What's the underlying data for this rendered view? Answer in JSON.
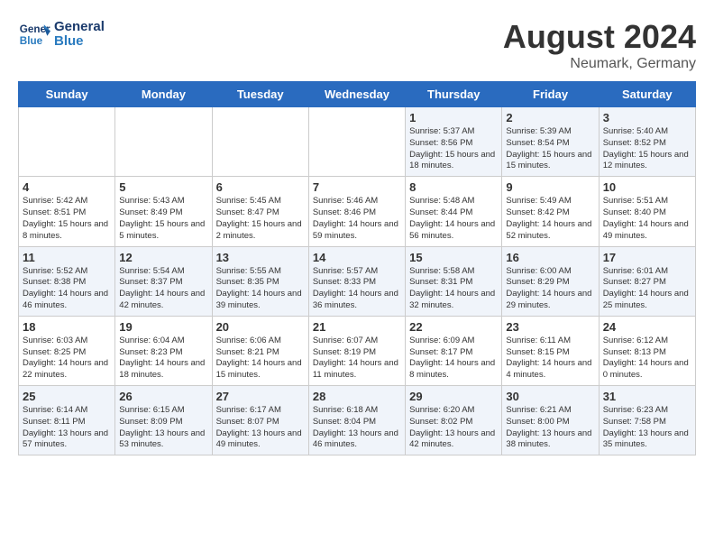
{
  "header": {
    "logo_line1": "General",
    "logo_line2": "Blue",
    "title": "August 2024",
    "subtitle": "Neumark, Germany"
  },
  "days_of_week": [
    "Sunday",
    "Monday",
    "Tuesday",
    "Wednesday",
    "Thursday",
    "Friday",
    "Saturday"
  ],
  "weeks": [
    [
      {
        "day": "",
        "content": ""
      },
      {
        "day": "",
        "content": ""
      },
      {
        "day": "",
        "content": ""
      },
      {
        "day": "",
        "content": ""
      },
      {
        "day": "1",
        "content": "Sunrise: 5:37 AM\nSunset: 8:56 PM\nDaylight: 15 hours\nand 18 minutes."
      },
      {
        "day": "2",
        "content": "Sunrise: 5:39 AM\nSunset: 8:54 PM\nDaylight: 15 hours\nand 15 minutes."
      },
      {
        "day": "3",
        "content": "Sunrise: 5:40 AM\nSunset: 8:52 PM\nDaylight: 15 hours\nand 12 minutes."
      }
    ],
    [
      {
        "day": "4",
        "content": "Sunrise: 5:42 AM\nSunset: 8:51 PM\nDaylight: 15 hours\nand 8 minutes."
      },
      {
        "day": "5",
        "content": "Sunrise: 5:43 AM\nSunset: 8:49 PM\nDaylight: 15 hours\nand 5 minutes."
      },
      {
        "day": "6",
        "content": "Sunrise: 5:45 AM\nSunset: 8:47 PM\nDaylight: 15 hours\nand 2 minutes."
      },
      {
        "day": "7",
        "content": "Sunrise: 5:46 AM\nSunset: 8:46 PM\nDaylight: 14 hours\nand 59 minutes."
      },
      {
        "day": "8",
        "content": "Sunrise: 5:48 AM\nSunset: 8:44 PM\nDaylight: 14 hours\nand 56 minutes."
      },
      {
        "day": "9",
        "content": "Sunrise: 5:49 AM\nSunset: 8:42 PM\nDaylight: 14 hours\nand 52 minutes."
      },
      {
        "day": "10",
        "content": "Sunrise: 5:51 AM\nSunset: 8:40 PM\nDaylight: 14 hours\nand 49 minutes."
      }
    ],
    [
      {
        "day": "11",
        "content": "Sunrise: 5:52 AM\nSunset: 8:38 PM\nDaylight: 14 hours\nand 46 minutes."
      },
      {
        "day": "12",
        "content": "Sunrise: 5:54 AM\nSunset: 8:37 PM\nDaylight: 14 hours\nand 42 minutes."
      },
      {
        "day": "13",
        "content": "Sunrise: 5:55 AM\nSunset: 8:35 PM\nDaylight: 14 hours\nand 39 minutes."
      },
      {
        "day": "14",
        "content": "Sunrise: 5:57 AM\nSunset: 8:33 PM\nDaylight: 14 hours\nand 36 minutes."
      },
      {
        "day": "15",
        "content": "Sunrise: 5:58 AM\nSunset: 8:31 PM\nDaylight: 14 hours\nand 32 minutes."
      },
      {
        "day": "16",
        "content": "Sunrise: 6:00 AM\nSunset: 8:29 PM\nDaylight: 14 hours\nand 29 minutes."
      },
      {
        "day": "17",
        "content": "Sunrise: 6:01 AM\nSunset: 8:27 PM\nDaylight: 14 hours\nand 25 minutes."
      }
    ],
    [
      {
        "day": "18",
        "content": "Sunrise: 6:03 AM\nSunset: 8:25 PM\nDaylight: 14 hours\nand 22 minutes."
      },
      {
        "day": "19",
        "content": "Sunrise: 6:04 AM\nSunset: 8:23 PM\nDaylight: 14 hours\nand 18 minutes."
      },
      {
        "day": "20",
        "content": "Sunrise: 6:06 AM\nSunset: 8:21 PM\nDaylight: 14 hours\nand 15 minutes."
      },
      {
        "day": "21",
        "content": "Sunrise: 6:07 AM\nSunset: 8:19 PM\nDaylight: 14 hours\nand 11 minutes."
      },
      {
        "day": "22",
        "content": "Sunrise: 6:09 AM\nSunset: 8:17 PM\nDaylight: 14 hours\nand 8 minutes."
      },
      {
        "day": "23",
        "content": "Sunrise: 6:11 AM\nSunset: 8:15 PM\nDaylight: 14 hours\nand 4 minutes."
      },
      {
        "day": "24",
        "content": "Sunrise: 6:12 AM\nSunset: 8:13 PM\nDaylight: 14 hours\nand 0 minutes."
      }
    ],
    [
      {
        "day": "25",
        "content": "Sunrise: 6:14 AM\nSunset: 8:11 PM\nDaylight: 13 hours\nand 57 minutes."
      },
      {
        "day": "26",
        "content": "Sunrise: 6:15 AM\nSunset: 8:09 PM\nDaylight: 13 hours\nand 53 minutes."
      },
      {
        "day": "27",
        "content": "Sunrise: 6:17 AM\nSunset: 8:07 PM\nDaylight: 13 hours\nand 49 minutes."
      },
      {
        "day": "28",
        "content": "Sunrise: 6:18 AM\nSunset: 8:04 PM\nDaylight: 13 hours\nand 46 minutes."
      },
      {
        "day": "29",
        "content": "Sunrise: 6:20 AM\nSunset: 8:02 PM\nDaylight: 13 hours\nand 42 minutes."
      },
      {
        "day": "30",
        "content": "Sunrise: 6:21 AM\nSunset: 8:00 PM\nDaylight: 13 hours\nand 38 minutes."
      },
      {
        "day": "31",
        "content": "Sunrise: 6:23 AM\nSunset: 7:58 PM\nDaylight: 13 hours\nand 35 minutes."
      }
    ]
  ]
}
